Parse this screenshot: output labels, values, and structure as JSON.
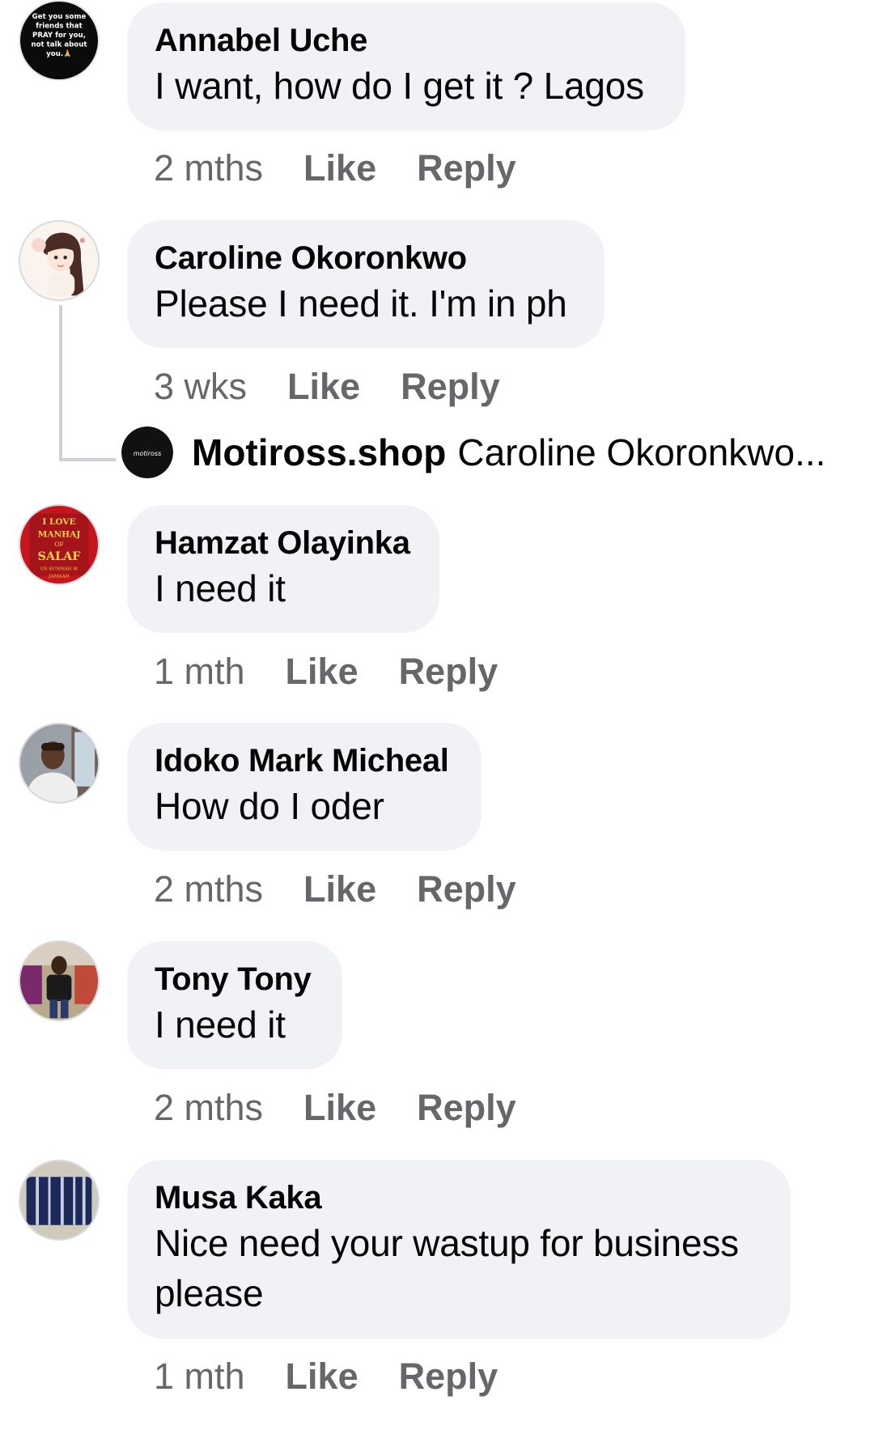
{
  "comments": [
    {
      "author": "Annabel Uche",
      "text": "I want, how do I get it ? Lagos",
      "time": "2 mths",
      "like": "Like",
      "reply": "Reply",
      "avatar_text": [
        "Get you some",
        "friends that",
        "PRAY for you,",
        "not talk about",
        "you.🙏"
      ]
    },
    {
      "author": "Caroline Okoronkwo",
      "text": "Please I need it. I'm in ph",
      "time": "3 wks",
      "like": "Like",
      "reply": "Reply"
    },
    {
      "author": "Hamzat Olayinka",
      "text": "I need it",
      "time": "1 mth",
      "like": "Like",
      "reply": "Reply",
      "avatar_text": [
        "I LOVE",
        "MANHAJ",
        "OF",
        "SALAF",
        "US SUNNAH W",
        "JAMAAH"
      ]
    },
    {
      "author": "Idoko Mark Micheal",
      "text": "How do I oder",
      "time": "2 mths",
      "like": "Like",
      "reply": "Reply"
    },
    {
      "author": "Tony Tony",
      "text": "I need it",
      "time": "2 mths",
      "like": "Like",
      "reply": "Reply"
    },
    {
      "author": "Musa Kaka",
      "text": "Nice need your wastup for business please",
      "time": "1 mth",
      "like": "Like",
      "reply": "Reply"
    }
  ],
  "reply_preview": {
    "author": "Motiross.shop",
    "text": "Caroline Okoronkwo...",
    "avatar_text": "motiross"
  },
  "colors": {
    "bubble": "#f0f2f5",
    "meta_text": "#65676b",
    "primary_text": "#050505",
    "thread_line": "#ced0d4"
  }
}
